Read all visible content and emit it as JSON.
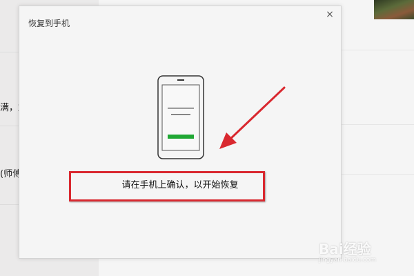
{
  "background": {
    "snippets": [
      "满，加",
      "(师傅"
    ],
    "avatar_icon": "avatar-photo"
  },
  "dialog": {
    "title": "恢复到手机",
    "close_label": "×",
    "message": "请在手机上确认，以开始恢复",
    "phone_icon": "phone-illustration",
    "phone_button_color": "#20a834"
  },
  "annotation": {
    "color": "#d9282f"
  },
  "watermark": {
    "text": "Bai经验",
    "sub": "jingyan.baidu.com"
  }
}
